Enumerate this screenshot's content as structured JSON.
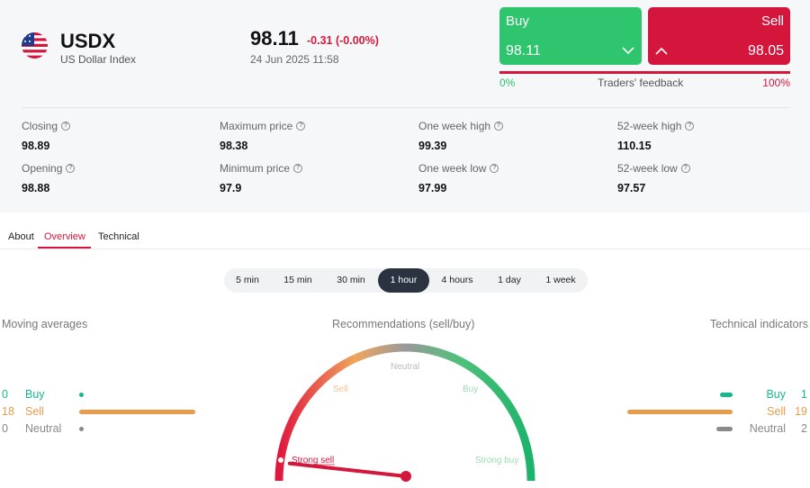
{
  "header": {
    "symbol": "USDX",
    "name": "US Dollar Index",
    "price": "98.11",
    "change": "-0.31 (-0.00%)",
    "datetime": "24 Jun 2025 11:58"
  },
  "trade": {
    "buy_label": "Buy",
    "buy_value": "98.11",
    "sell_label": "Sell",
    "sell_value": "98.05",
    "feedback_left": "0%",
    "feedback_label": "Traders' feedback",
    "feedback_right": "100%",
    "buy_share": 0.0
  },
  "stats": [
    {
      "label": "Closing",
      "value": "98.89"
    },
    {
      "label": "Maximum price",
      "value": "98.38"
    },
    {
      "label": "One week high",
      "value": "99.39"
    },
    {
      "label": "52-week high",
      "value": "110.15"
    },
    {
      "label": "Opening",
      "value": "98.88"
    },
    {
      "label": "Minimum price",
      "value": "97.9"
    },
    {
      "label": "One week low",
      "value": "97.99"
    },
    {
      "label": "52-week low",
      "value": "97.57"
    }
  ],
  "tabs": [
    "About",
    "Overview",
    "Technical"
  ],
  "active_tab": "Overview",
  "periods": [
    "5 min",
    "15 min",
    "30 min",
    "1 hour",
    "4 hours",
    "1 day",
    "1 week"
  ],
  "active_period": "1 hour",
  "moving_averages": {
    "title": "Moving averages",
    "buy": {
      "count": "0",
      "label": "Buy"
    },
    "sell": {
      "count": "18",
      "label": "Sell"
    },
    "neutral": {
      "count": "0",
      "label": "Neutral"
    }
  },
  "recommendations": {
    "title": "Recommendations (sell/buy)",
    "labels": {
      "strong_sell": "Strong sell",
      "sell": "Sell",
      "neutral": "Neutral",
      "buy": "Buy",
      "strong_buy": "Strong buy"
    },
    "needle_value": -0.93
  },
  "technical_indicators": {
    "title": "Technical indicators",
    "buy": {
      "count": "1",
      "label": "Buy"
    },
    "sell": {
      "count": "19",
      "label": "Sell"
    },
    "neutral": {
      "count": "2",
      "label": "Neutral"
    }
  },
  "colors": {
    "buy": "#2fc46e",
    "sell": "#d4163c",
    "sell_indicator": "#e79b4c",
    "neutral": "#8a8a8a",
    "teal": "#17b890"
  }
}
